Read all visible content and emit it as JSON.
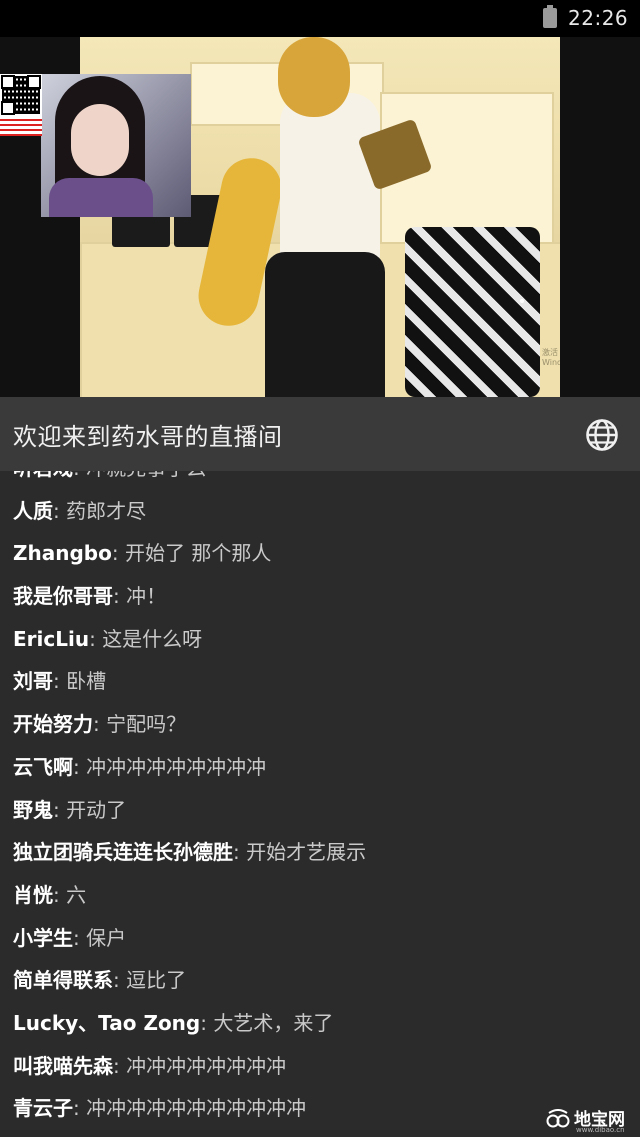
{
  "status_bar": {
    "time": "22:26",
    "battery_icon": "battery-icon"
  },
  "video": {
    "pip_qr_icon": "qr-code-icon",
    "windows_watermark": "激活 Windows"
  },
  "title_bar": {
    "title": "欢迎来到药水哥的直播间",
    "globe_icon": "globe-icon"
  },
  "chat": {
    "messages": [
      {
        "user": "听君戏",
        "text": "冲就完事了么"
      },
      {
        "user": "人质",
        "text": "药郎才尽"
      },
      {
        "user": "Zhangbo",
        "text": "开始了 那个那人"
      },
      {
        "user": "我是你哥哥",
        "text": "冲！"
      },
      {
        "user": "EricLiu",
        "text": "这是什么呀"
      },
      {
        "user": "刘哥",
        "text": "卧槽"
      },
      {
        "user": "开始努力",
        "text": "宁配吗？"
      },
      {
        "user": "云飞啊",
        "text": "冲冲冲冲冲冲冲冲冲"
      },
      {
        "user": "野鬼",
        "text": "开动了"
      },
      {
        "user": "独立团骑兵连连长孙德胜",
        "text": "开始才艺展示"
      },
      {
        "user": "肖恍",
        "text": "六"
      },
      {
        "user": "小学生",
        "text": "保户"
      },
      {
        "user": "简单得联系",
        "text": "逗比了"
      },
      {
        "user": "Lucky、Tao Zong",
        "text": "大艺术，来了"
      },
      {
        "user": "叫我喵先森",
        "text": "冲冲冲冲冲冲冲冲"
      },
      {
        "user": "青云子",
        "text": "冲冲冲冲冲冲冲冲冲冲冲"
      }
    ]
  },
  "watermark": {
    "brand": "地宝网",
    "url": "www.dibao.cn"
  }
}
